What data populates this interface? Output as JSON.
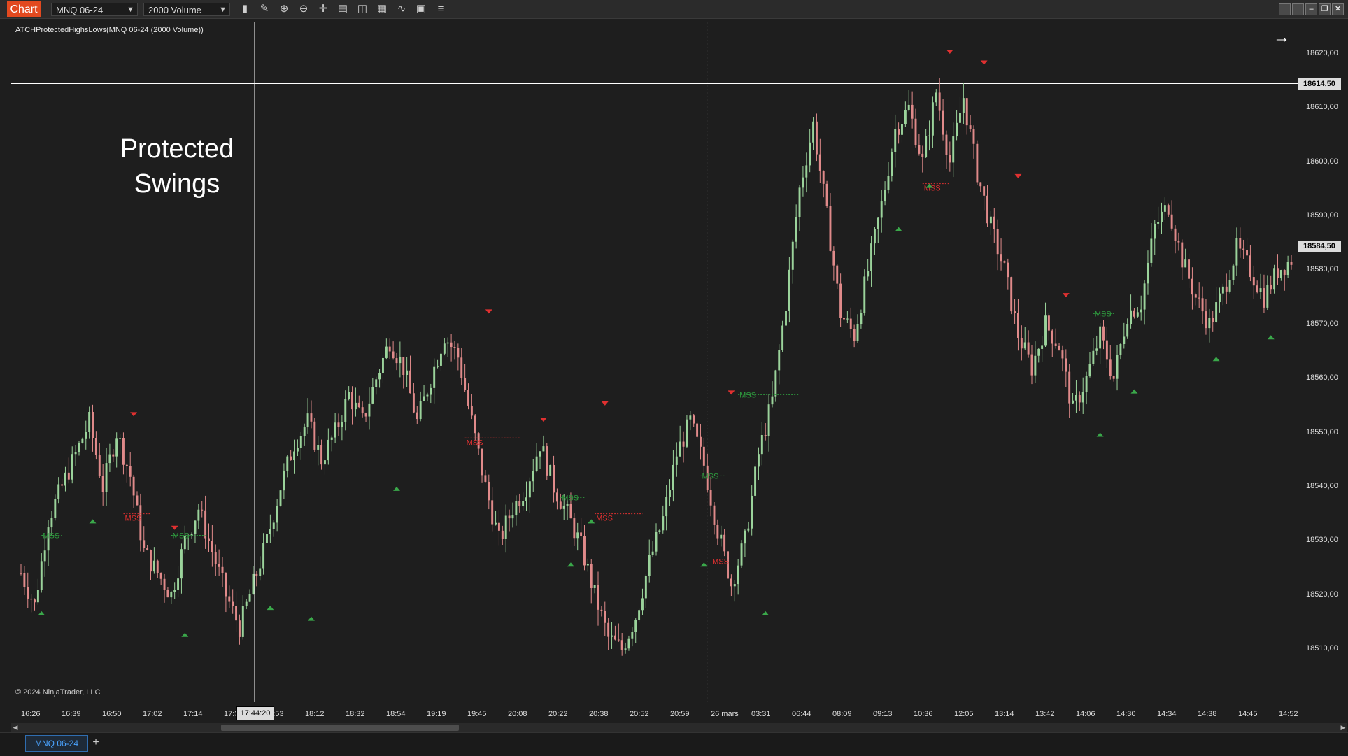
{
  "toolbar": {
    "chart_tab": "Chart",
    "instrument": "MNQ 06-24",
    "bar_type": "2000 Volume",
    "icons": [
      "bars-icon",
      "pencil-icon",
      "zoom-in-icon",
      "zoom-out-icon",
      "crosshair-icon",
      "properties-icon",
      "data-box-icon",
      "template-icon",
      "indicators-icon",
      "strategies-icon",
      "list-icon"
    ]
  },
  "chart": {
    "indicator_label": "ATCHProtectedHighsLows(MNQ 06-24 (2000 Volume))",
    "annotation_line1": "Protected",
    "annotation_line2": "Swings",
    "copyright": "© 2024 NinjaTrader, LLC",
    "cursor_price": "18614,50",
    "last_price": "18584,50",
    "cursor_time": "17:44:20",
    "mss_label": "MSS",
    "colors": {
      "up": "#9bd39b",
      "down": "#e08a8a",
      "swing_high": "#e03030",
      "swing_low": "#3aa84a",
      "mss_bear": "#e03030",
      "mss_bull": "#2e9a3e"
    }
  },
  "chart_data": {
    "type": "candlestick",
    "y_ticks": [
      "18620,00",
      "18610,00",
      "18600,00",
      "18590,00",
      "18580,00",
      "18570,00",
      "18560,00",
      "18550,00",
      "18540,00",
      "18530,00",
      "18520,00",
      "18510,00"
    ],
    "x_ticks": [
      "16:26",
      "16:39",
      "16:50",
      "17:02",
      "17:14",
      "17:33",
      "17:53",
      "18:12",
      "18:32",
      "18:54",
      "19:19",
      "19:45",
      "20:08",
      "20:22",
      "20:38",
      "20:52",
      "20:59",
      "26 mars",
      "03:31",
      "06:44",
      "08:09",
      "09:13",
      "10:36",
      "12:05",
      "13:14",
      "13:42",
      "14:06",
      "14:30",
      "14:34",
      "14:38",
      "14:45",
      "14:52"
    ],
    "ylim": [
      18507,
      18622
    ],
    "path": [
      [
        0,
        18524
      ],
      [
        4,
        18518
      ],
      [
        8,
        18534
      ],
      [
        12,
        18540
      ],
      [
        16,
        18546
      ],
      [
        20,
        18552
      ],
      [
        24,
        18540
      ],
      [
        28,
        18550
      ],
      [
        32,
        18542
      ],
      [
        36,
        18528
      ],
      [
        40,
        18524
      ],
      [
        44,
        18520
      ],
      [
        48,
        18530
      ],
      [
        52,
        18536
      ],
      [
        56,
        18528
      ],
      [
        60,
        18520
      ],
      [
        64,
        18514
      ],
      [
        68,
        18522
      ],
      [
        72,
        18530
      ],
      [
        76,
        18540
      ],
      [
        80,
        18548
      ],
      [
        84,
        18552
      ],
      [
        88,
        18545
      ],
      [
        92,
        18550
      ],
      [
        96,
        18557
      ],
      [
        100,
        18552
      ],
      [
        104,
        18560
      ],
      [
        108,
        18567
      ],
      [
        112,
        18562
      ],
      [
        116,
        18552
      ],
      [
        120,
        18560
      ],
      [
        124,
        18568
      ],
      [
        128,
        18564
      ],
      [
        132,
        18552
      ],
      [
        136,
        18540
      ],
      [
        140,
        18530
      ],
      [
        144,
        18536
      ],
      [
        148,
        18540
      ],
      [
        152,
        18548
      ],
      [
        156,
        18540
      ],
      [
        160,
        18535
      ],
      [
        164,
        18529
      ],
      [
        168,
        18520
      ],
      [
        172,
        18512
      ],
      [
        176,
        18510
      ],
      [
        180,
        18516
      ],
      [
        184,
        18526
      ],
      [
        188,
        18534
      ],
      [
        192,
        18546
      ],
      [
        196,
        18552
      ],
      [
        200,
        18544
      ],
      [
        204,
        18532
      ],
      [
        208,
        18522
      ],
      [
        212,
        18530
      ],
      [
        216,
        18546
      ],
      [
        220,
        18556
      ],
      [
        224,
        18574
      ],
      [
        228,
        18595
      ],
      [
        232,
        18607
      ],
      [
        236,
        18590
      ],
      [
        240,
        18572
      ],
      [
        244,
        18568
      ],
      [
        248,
        18580
      ],
      [
        252,
        18592
      ],
      [
        256,
        18606
      ],
      [
        260,
        18610
      ],
      [
        264,
        18600
      ],
      [
        268,
        18613
      ],
      [
        272,
        18600
      ],
      [
        276,
        18612
      ],
      [
        280,
        18598
      ],
      [
        284,
        18588
      ],
      [
        288,
        18580
      ],
      [
        292,
        18568
      ],
      [
        296,
        18562
      ],
      [
        300,
        18570
      ],
      [
        304,
        18566
      ],
      [
        308,
        18554
      ],
      [
        312,
        18560
      ],
      [
        316,
        18568
      ],
      [
        320,
        18560
      ],
      [
        324,
        18572
      ],
      [
        328,
        18574
      ],
      [
        332,
        18588
      ],
      [
        336,
        18592
      ],
      [
        340,
        18582
      ],
      [
        344,
        18575
      ],
      [
        348,
        18570
      ],
      [
        352,
        18576
      ],
      [
        356,
        18584
      ],
      [
        360,
        18580
      ],
      [
        364,
        18575
      ],
      [
        368,
        18580
      ],
      [
        372,
        18582
      ]
    ],
    "swing_highs": [
      {
        "i": 33,
        "price": 18553
      },
      {
        "i": 45,
        "price": 18532
      },
      {
        "i": 137,
        "price": 18572
      },
      {
        "i": 153,
        "price": 18552
      },
      {
        "i": 171,
        "price": 18555
      },
      {
        "i": 208,
        "price": 18557
      },
      {
        "i": 272,
        "price": 18620
      },
      {
        "i": 282,
        "price": 18618
      },
      {
        "i": 292,
        "price": 18597
      },
      {
        "i": 306,
        "price": 18575
      }
    ],
    "swing_lows": [
      {
        "i": 6,
        "price": 18517
      },
      {
        "i": 21,
        "price": 18534
      },
      {
        "i": 48,
        "price": 18513
      },
      {
        "i": 73,
        "price": 18518
      },
      {
        "i": 85,
        "price": 18516
      },
      {
        "i": 110,
        "price": 18540
      },
      {
        "i": 161,
        "price": 18526
      },
      {
        "i": 167,
        "price": 18534
      },
      {
        "i": 200,
        "price": 18526
      },
      {
        "i": 218,
        "price": 18517
      },
      {
        "i": 257,
        "price": 18588
      },
      {
        "i": 266,
        "price": 18596
      },
      {
        "i": 316,
        "price": 18550
      },
      {
        "i": 326,
        "price": 18558
      },
      {
        "i": 350,
        "price": 18564
      },
      {
        "i": 366,
        "price": 18568
      }
    ],
    "mss": [
      {
        "i0": 30,
        "i1": 38,
        "price": 18535,
        "kind": "bear"
      },
      {
        "i0": 130,
        "i1": 146,
        "price": 18549,
        "kind": "bear"
      },
      {
        "i0": 168,
        "i1": 182,
        "price": 18535,
        "kind": "bear"
      },
      {
        "i0": 202,
        "i1": 219,
        "price": 18527,
        "kind": "bear"
      },
      {
        "i0": 264,
        "i1": 272,
        "price": 18596,
        "kind": "bear"
      },
      {
        "i0": 6,
        "i1": 12,
        "price": 18531,
        "kind": "bull"
      },
      {
        "i0": 44,
        "i1": 54,
        "price": 18531,
        "kind": "bull"
      },
      {
        "i0": 158,
        "i1": 165,
        "price": 18538,
        "kind": "bull"
      },
      {
        "i0": 199,
        "i1": 206,
        "price": 18542,
        "kind": "bull"
      },
      {
        "i0": 210,
        "i1": 228,
        "price": 18557,
        "kind": "bull"
      },
      {
        "i0": 314,
        "i1": 320,
        "price": 18572,
        "kind": "bull"
      }
    ]
  }
}
